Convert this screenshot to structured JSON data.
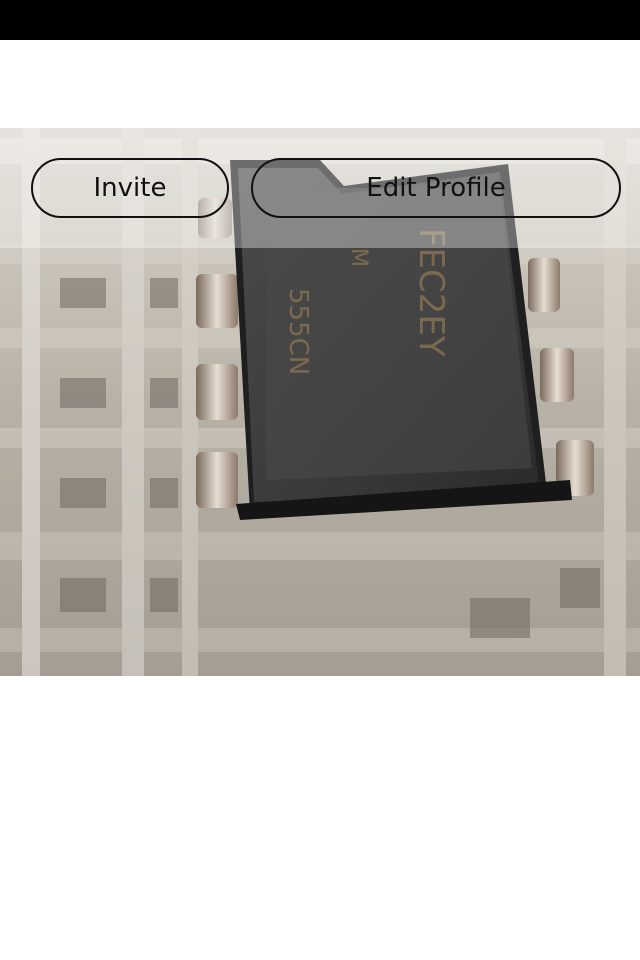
{
  "status_bar": {},
  "cover_photo": {
    "description_icon": "photo"
  },
  "actions": {
    "invite_label": "Invite",
    "edit_profile_label": "Edit Profile"
  },
  "colors": {
    "status_bar": "#000000",
    "background": "#ffffff",
    "pill_border": "#111111",
    "pill_text": "#111111"
  }
}
